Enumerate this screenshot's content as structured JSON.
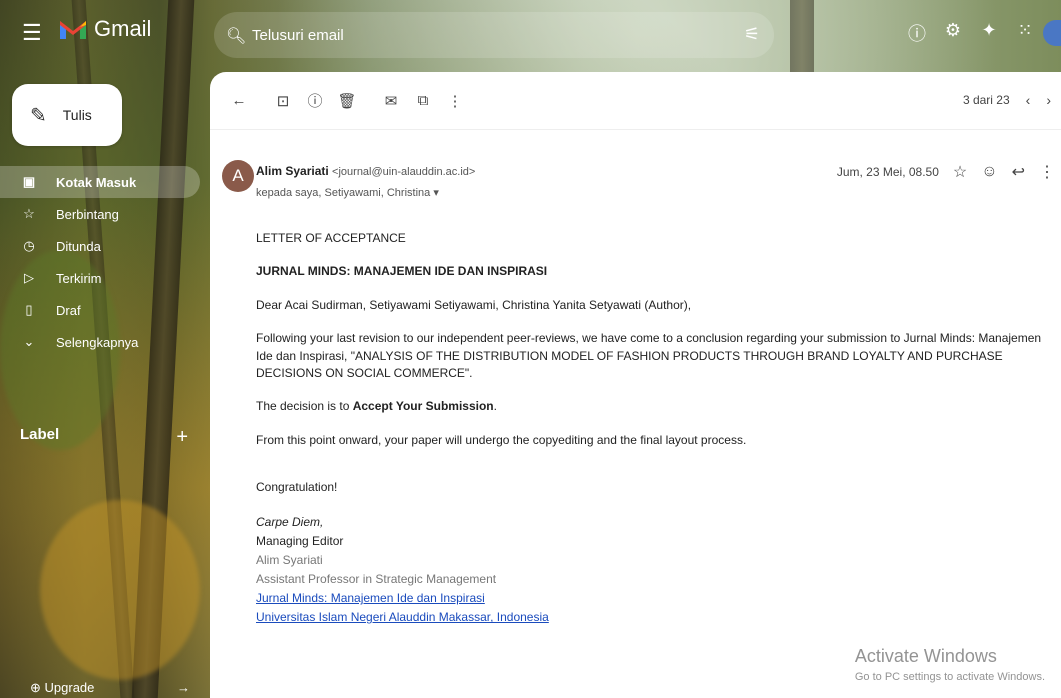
{
  "header": {
    "app_name": "Gmail",
    "search_placeholder": "Telusuri email"
  },
  "compose": {
    "label": "Tulis"
  },
  "sidebar": {
    "items": [
      {
        "label": "Kotak Masuk",
        "icon": "inbox-icon",
        "active": true
      },
      {
        "label": "Berbintang",
        "icon": "star-icon",
        "active": false
      },
      {
        "label": "Ditunda",
        "icon": "clock-icon",
        "active": false
      },
      {
        "label": "Terkirim",
        "icon": "send-icon",
        "active": false
      },
      {
        "label": "Draf",
        "icon": "draft-icon",
        "active": false
      },
      {
        "label": "Selengkapnya",
        "icon": "chevron-down-icon",
        "active": false
      }
    ],
    "label_heading": "Label",
    "upgrade": "Upgrade"
  },
  "toolbar": {
    "pager": "3 dari 23"
  },
  "email": {
    "sender_name": "Alim Syariati",
    "sender_email": "<journal@uin-alauddin.ac.id>",
    "avatar_letter": "A",
    "recipients": "kepada saya, Setiyawami, Christina",
    "date": "Jum, 23 Mei, 08.50",
    "body": {
      "title": "LETTER OF ACCEPTANCE",
      "journal": "JURNAL MINDS: MANAJEMEN IDE DAN INSPIRASI",
      "greeting": "Dear Acai Sudirman, Setiyawami Setiyawami, Christina Yanita Setyawati (Author),",
      "para1": "Following your last revision to our independent peer-reviews, we have come to a conclusion regarding your submission to Jurnal Minds: Manajemen Ide dan Inspirasi, \"ANALYSIS OF THE DISTRIBUTION MODEL OF FASHION PRODUCTS THROUGH BRAND LOYALTY AND PURCHASE DECISIONS ON SOCIAL COMMERCE\".",
      "decision_prefix": "The decision is to ",
      "decision": "Accept Your Submission",
      "decision_suffix": ".",
      "para3": "From this point onward, your paper will undergo the copyediting and the final layout process.",
      "closing": "Congratulation!",
      "signature": {
        "motto": "Carpe Diem,",
        "role": "Managing Editor",
        "name": "Alim Syariati",
        "title": "Assistant Professor in Strategic Management",
        "link1": "Jurnal Minds: Manajemen Ide dan Inspirasi",
        "link2": "Universitas Islam Negeri Alauddin Makassar, Indonesia"
      }
    }
  },
  "watermark": {
    "title": "Activate Windows",
    "subtitle": "Go to PC settings to activate Windows."
  },
  "colors": {
    "link": "#1a4bbd",
    "avatar": "#8a5a4a",
    "gmail_red": "#ea4335"
  }
}
